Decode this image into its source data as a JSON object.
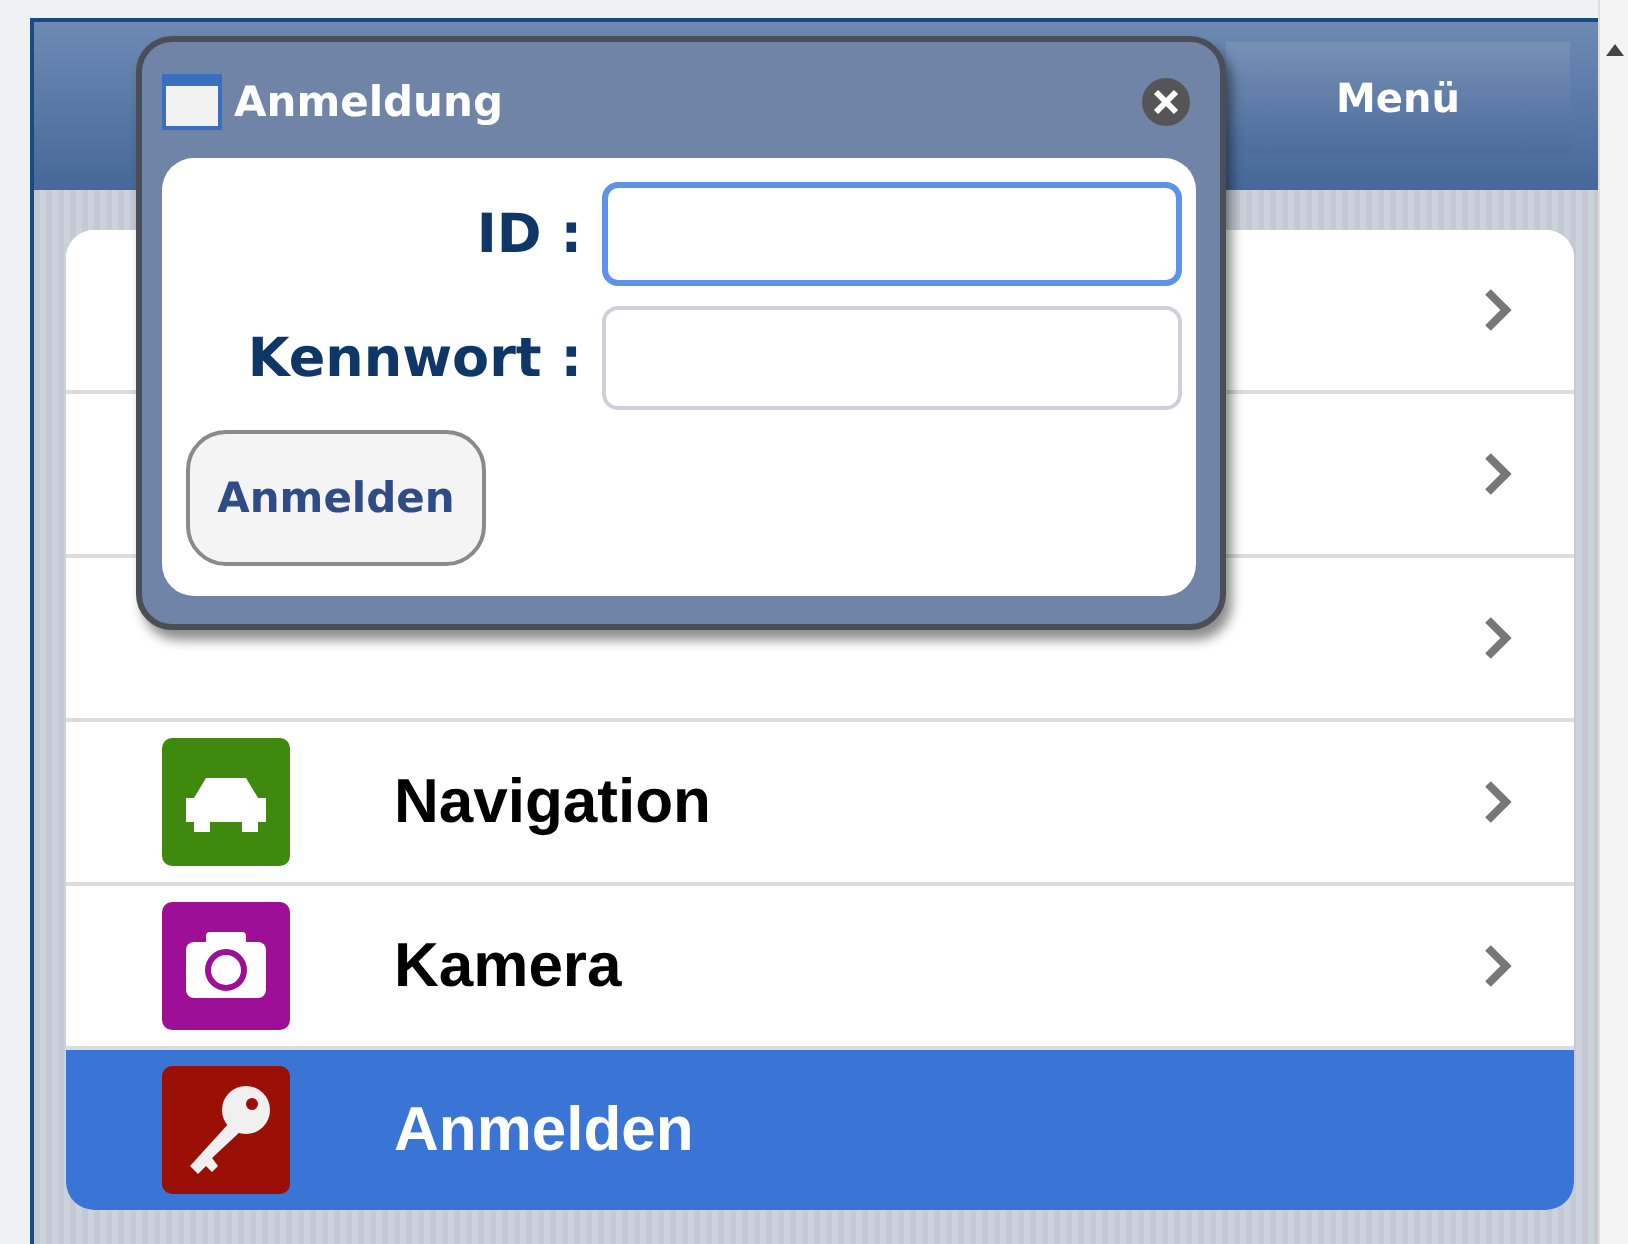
{
  "header": {
    "menu_button": "Menü"
  },
  "menu": {
    "items": [
      {
        "kind": "blank",
        "selected": false
      },
      {
        "kind": "blank",
        "selected": false
      },
      {
        "kind": "blank",
        "selected": false
      },
      {
        "kind": "car",
        "label": "Navigation",
        "color": "#3f8a0e",
        "selected": false
      },
      {
        "kind": "camera",
        "label": "Kamera",
        "color": "#9c0f96",
        "selected": false
      },
      {
        "kind": "key",
        "label": "Anmelden",
        "color": "#9a0f06",
        "selected": true
      }
    ]
  },
  "dialog": {
    "title": "Anmeldung",
    "fields": [
      {
        "label": "ID :",
        "focused": true
      },
      {
        "label": "Kennwort :",
        "focused": false
      }
    ],
    "button": "Anmelden"
  }
}
